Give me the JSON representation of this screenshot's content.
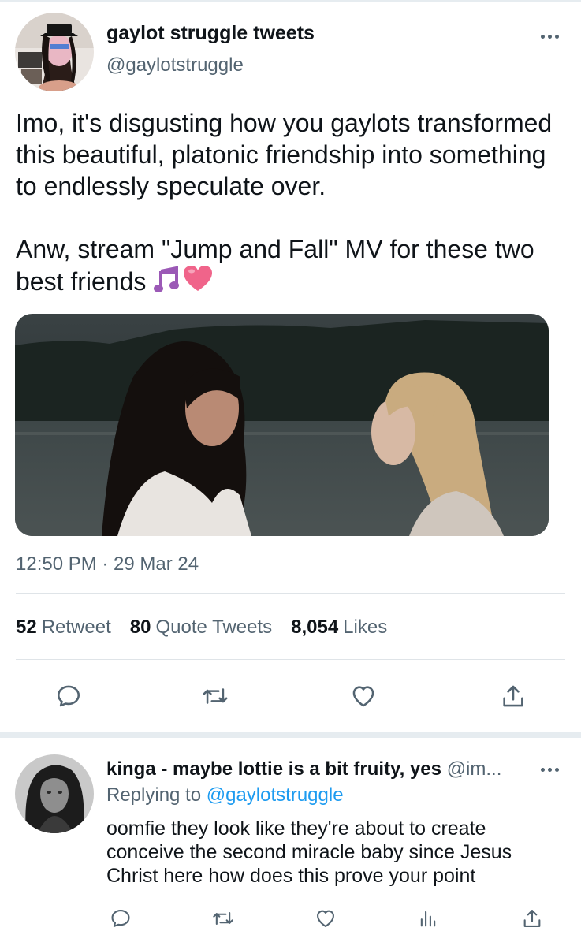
{
  "tweet": {
    "display_name": "gaylot struggle tweets",
    "handle": "@gaylotstruggle",
    "text_paragraph_1": "Imo, it's disgusting how you gaylots transformed this beautiful, platonic friendship into something to endlessly speculate over.",
    "text_paragraph_2": "Anw, stream \"Jump and Fall\" MV for  these two best friends",
    "emojis": [
      "musical-notes-icon",
      "pink-heart-icon"
    ],
    "timestamp": "12:50 PM · 29 Mar 24",
    "stats": {
      "retweets_count": "52",
      "retweets_label": "Retweet",
      "quotes_count": "80",
      "quotes_label": "Quote Tweets",
      "likes_count": "8,054",
      "likes_label": "Likes"
    },
    "actions": [
      "reply-icon",
      "retweet-icon",
      "like-icon",
      "share-icon"
    ]
  },
  "reply": {
    "display_name": "kinga - maybe lottie is a bit fruity, yes",
    "handle": "@im...",
    "replying_prefix": "Replying to",
    "replying_to": "@gaylotstruggle",
    "text": "oomfie they look like they're about to create conceive the second miracle baby since Jesus Christ here how does this prove your point",
    "actions": [
      "reply-icon",
      "retweet-icon",
      "like-icon",
      "analytics-icon",
      "share-icon"
    ]
  },
  "colors": {
    "text_primary": "#0f1419",
    "text_secondary": "#536471",
    "link": "#1d9bf0",
    "divider": "#dfe4e8"
  }
}
